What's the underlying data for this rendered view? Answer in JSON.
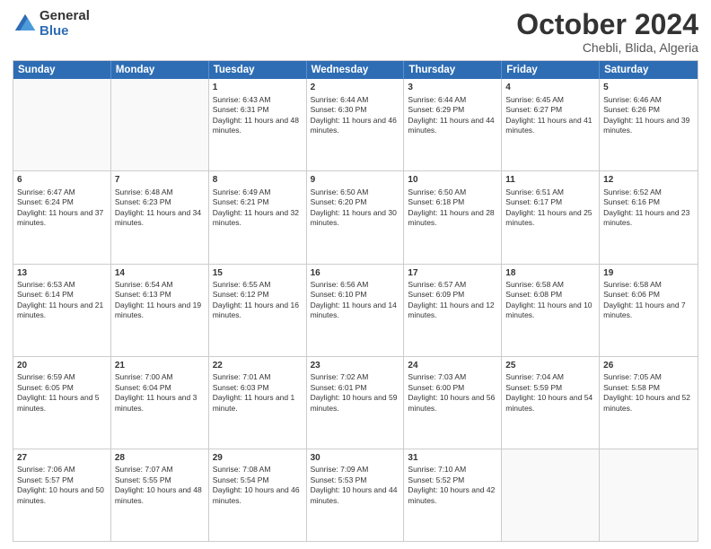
{
  "logo": {
    "general": "General",
    "blue": "Blue"
  },
  "header": {
    "month": "October 2024",
    "location": "Chebli, Blida, Algeria"
  },
  "weekdays": [
    "Sunday",
    "Monday",
    "Tuesday",
    "Wednesday",
    "Thursday",
    "Friday",
    "Saturday"
  ],
  "rows": [
    [
      {
        "day": "",
        "content": "",
        "empty": true
      },
      {
        "day": "",
        "content": "",
        "empty": true
      },
      {
        "day": "1",
        "content": "Sunrise: 6:43 AM\nSunset: 6:31 PM\nDaylight: 11 hours and 48 minutes."
      },
      {
        "day": "2",
        "content": "Sunrise: 6:44 AM\nSunset: 6:30 PM\nDaylight: 11 hours and 46 minutes."
      },
      {
        "day": "3",
        "content": "Sunrise: 6:44 AM\nSunset: 6:29 PM\nDaylight: 11 hours and 44 minutes."
      },
      {
        "day": "4",
        "content": "Sunrise: 6:45 AM\nSunset: 6:27 PM\nDaylight: 11 hours and 41 minutes."
      },
      {
        "day": "5",
        "content": "Sunrise: 6:46 AM\nSunset: 6:26 PM\nDaylight: 11 hours and 39 minutes."
      }
    ],
    [
      {
        "day": "6",
        "content": "Sunrise: 6:47 AM\nSunset: 6:24 PM\nDaylight: 11 hours and 37 minutes."
      },
      {
        "day": "7",
        "content": "Sunrise: 6:48 AM\nSunset: 6:23 PM\nDaylight: 11 hours and 34 minutes."
      },
      {
        "day": "8",
        "content": "Sunrise: 6:49 AM\nSunset: 6:21 PM\nDaylight: 11 hours and 32 minutes."
      },
      {
        "day": "9",
        "content": "Sunrise: 6:50 AM\nSunset: 6:20 PM\nDaylight: 11 hours and 30 minutes."
      },
      {
        "day": "10",
        "content": "Sunrise: 6:50 AM\nSunset: 6:18 PM\nDaylight: 11 hours and 28 minutes."
      },
      {
        "day": "11",
        "content": "Sunrise: 6:51 AM\nSunset: 6:17 PM\nDaylight: 11 hours and 25 minutes."
      },
      {
        "day": "12",
        "content": "Sunrise: 6:52 AM\nSunset: 6:16 PM\nDaylight: 11 hours and 23 minutes."
      }
    ],
    [
      {
        "day": "13",
        "content": "Sunrise: 6:53 AM\nSunset: 6:14 PM\nDaylight: 11 hours and 21 minutes."
      },
      {
        "day": "14",
        "content": "Sunrise: 6:54 AM\nSunset: 6:13 PM\nDaylight: 11 hours and 19 minutes."
      },
      {
        "day": "15",
        "content": "Sunrise: 6:55 AM\nSunset: 6:12 PM\nDaylight: 11 hours and 16 minutes."
      },
      {
        "day": "16",
        "content": "Sunrise: 6:56 AM\nSunset: 6:10 PM\nDaylight: 11 hours and 14 minutes."
      },
      {
        "day": "17",
        "content": "Sunrise: 6:57 AM\nSunset: 6:09 PM\nDaylight: 11 hours and 12 minutes."
      },
      {
        "day": "18",
        "content": "Sunrise: 6:58 AM\nSunset: 6:08 PM\nDaylight: 11 hours and 10 minutes."
      },
      {
        "day": "19",
        "content": "Sunrise: 6:58 AM\nSunset: 6:06 PM\nDaylight: 11 hours and 7 minutes."
      }
    ],
    [
      {
        "day": "20",
        "content": "Sunrise: 6:59 AM\nSunset: 6:05 PM\nDaylight: 11 hours and 5 minutes."
      },
      {
        "day": "21",
        "content": "Sunrise: 7:00 AM\nSunset: 6:04 PM\nDaylight: 11 hours and 3 minutes."
      },
      {
        "day": "22",
        "content": "Sunrise: 7:01 AM\nSunset: 6:03 PM\nDaylight: 11 hours and 1 minute."
      },
      {
        "day": "23",
        "content": "Sunrise: 7:02 AM\nSunset: 6:01 PM\nDaylight: 10 hours and 59 minutes."
      },
      {
        "day": "24",
        "content": "Sunrise: 7:03 AM\nSunset: 6:00 PM\nDaylight: 10 hours and 56 minutes."
      },
      {
        "day": "25",
        "content": "Sunrise: 7:04 AM\nSunset: 5:59 PM\nDaylight: 10 hours and 54 minutes."
      },
      {
        "day": "26",
        "content": "Sunrise: 7:05 AM\nSunset: 5:58 PM\nDaylight: 10 hours and 52 minutes."
      }
    ],
    [
      {
        "day": "27",
        "content": "Sunrise: 7:06 AM\nSunset: 5:57 PM\nDaylight: 10 hours and 50 minutes."
      },
      {
        "day": "28",
        "content": "Sunrise: 7:07 AM\nSunset: 5:55 PM\nDaylight: 10 hours and 48 minutes."
      },
      {
        "day": "29",
        "content": "Sunrise: 7:08 AM\nSunset: 5:54 PM\nDaylight: 10 hours and 46 minutes."
      },
      {
        "day": "30",
        "content": "Sunrise: 7:09 AM\nSunset: 5:53 PM\nDaylight: 10 hours and 44 minutes."
      },
      {
        "day": "31",
        "content": "Sunrise: 7:10 AM\nSunset: 5:52 PM\nDaylight: 10 hours and 42 minutes."
      },
      {
        "day": "",
        "content": "",
        "empty": true
      },
      {
        "day": "",
        "content": "",
        "empty": true
      }
    ]
  ]
}
